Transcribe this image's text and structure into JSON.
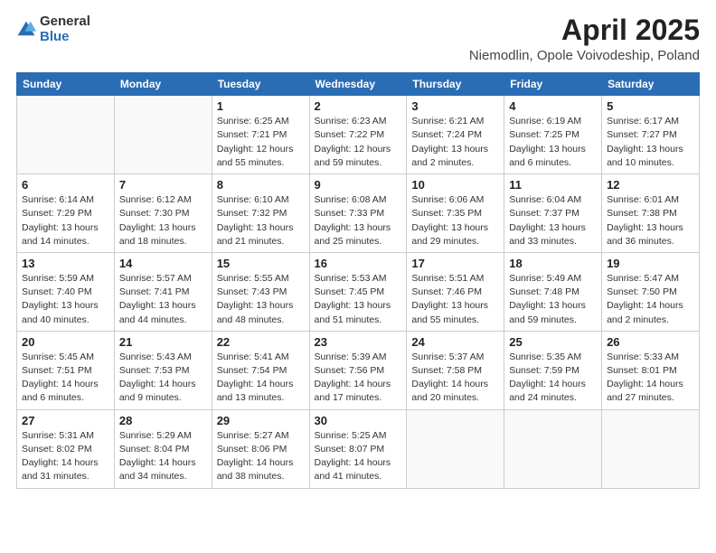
{
  "header": {
    "logo_general": "General",
    "logo_blue": "Blue",
    "title": "April 2025",
    "location": "Niemodlin, Opole Voivodeship, Poland"
  },
  "weekdays": [
    "Sunday",
    "Monday",
    "Tuesday",
    "Wednesday",
    "Thursday",
    "Friday",
    "Saturday"
  ],
  "weeks": [
    [
      {
        "day": "",
        "info": ""
      },
      {
        "day": "",
        "info": ""
      },
      {
        "day": "1",
        "info": "Sunrise: 6:25 AM\nSunset: 7:21 PM\nDaylight: 12 hours and 55 minutes."
      },
      {
        "day": "2",
        "info": "Sunrise: 6:23 AM\nSunset: 7:22 PM\nDaylight: 12 hours and 59 minutes."
      },
      {
        "day": "3",
        "info": "Sunrise: 6:21 AM\nSunset: 7:24 PM\nDaylight: 13 hours and 2 minutes."
      },
      {
        "day": "4",
        "info": "Sunrise: 6:19 AM\nSunset: 7:25 PM\nDaylight: 13 hours and 6 minutes."
      },
      {
        "day": "5",
        "info": "Sunrise: 6:17 AM\nSunset: 7:27 PM\nDaylight: 13 hours and 10 minutes."
      }
    ],
    [
      {
        "day": "6",
        "info": "Sunrise: 6:14 AM\nSunset: 7:29 PM\nDaylight: 13 hours and 14 minutes."
      },
      {
        "day": "7",
        "info": "Sunrise: 6:12 AM\nSunset: 7:30 PM\nDaylight: 13 hours and 18 minutes."
      },
      {
        "day": "8",
        "info": "Sunrise: 6:10 AM\nSunset: 7:32 PM\nDaylight: 13 hours and 21 minutes."
      },
      {
        "day": "9",
        "info": "Sunrise: 6:08 AM\nSunset: 7:33 PM\nDaylight: 13 hours and 25 minutes."
      },
      {
        "day": "10",
        "info": "Sunrise: 6:06 AM\nSunset: 7:35 PM\nDaylight: 13 hours and 29 minutes."
      },
      {
        "day": "11",
        "info": "Sunrise: 6:04 AM\nSunset: 7:37 PM\nDaylight: 13 hours and 33 minutes."
      },
      {
        "day": "12",
        "info": "Sunrise: 6:01 AM\nSunset: 7:38 PM\nDaylight: 13 hours and 36 minutes."
      }
    ],
    [
      {
        "day": "13",
        "info": "Sunrise: 5:59 AM\nSunset: 7:40 PM\nDaylight: 13 hours and 40 minutes."
      },
      {
        "day": "14",
        "info": "Sunrise: 5:57 AM\nSunset: 7:41 PM\nDaylight: 13 hours and 44 minutes."
      },
      {
        "day": "15",
        "info": "Sunrise: 5:55 AM\nSunset: 7:43 PM\nDaylight: 13 hours and 48 minutes."
      },
      {
        "day": "16",
        "info": "Sunrise: 5:53 AM\nSunset: 7:45 PM\nDaylight: 13 hours and 51 minutes."
      },
      {
        "day": "17",
        "info": "Sunrise: 5:51 AM\nSunset: 7:46 PM\nDaylight: 13 hours and 55 minutes."
      },
      {
        "day": "18",
        "info": "Sunrise: 5:49 AM\nSunset: 7:48 PM\nDaylight: 13 hours and 59 minutes."
      },
      {
        "day": "19",
        "info": "Sunrise: 5:47 AM\nSunset: 7:50 PM\nDaylight: 14 hours and 2 minutes."
      }
    ],
    [
      {
        "day": "20",
        "info": "Sunrise: 5:45 AM\nSunset: 7:51 PM\nDaylight: 14 hours and 6 minutes."
      },
      {
        "day": "21",
        "info": "Sunrise: 5:43 AM\nSunset: 7:53 PM\nDaylight: 14 hours and 9 minutes."
      },
      {
        "day": "22",
        "info": "Sunrise: 5:41 AM\nSunset: 7:54 PM\nDaylight: 14 hours and 13 minutes."
      },
      {
        "day": "23",
        "info": "Sunrise: 5:39 AM\nSunset: 7:56 PM\nDaylight: 14 hours and 17 minutes."
      },
      {
        "day": "24",
        "info": "Sunrise: 5:37 AM\nSunset: 7:58 PM\nDaylight: 14 hours and 20 minutes."
      },
      {
        "day": "25",
        "info": "Sunrise: 5:35 AM\nSunset: 7:59 PM\nDaylight: 14 hours and 24 minutes."
      },
      {
        "day": "26",
        "info": "Sunrise: 5:33 AM\nSunset: 8:01 PM\nDaylight: 14 hours and 27 minutes."
      }
    ],
    [
      {
        "day": "27",
        "info": "Sunrise: 5:31 AM\nSunset: 8:02 PM\nDaylight: 14 hours and 31 minutes."
      },
      {
        "day": "28",
        "info": "Sunrise: 5:29 AM\nSunset: 8:04 PM\nDaylight: 14 hours and 34 minutes."
      },
      {
        "day": "29",
        "info": "Sunrise: 5:27 AM\nSunset: 8:06 PM\nDaylight: 14 hours and 38 minutes."
      },
      {
        "day": "30",
        "info": "Sunrise: 5:25 AM\nSunset: 8:07 PM\nDaylight: 14 hours and 41 minutes."
      },
      {
        "day": "",
        "info": ""
      },
      {
        "day": "",
        "info": ""
      },
      {
        "day": "",
        "info": ""
      }
    ]
  ]
}
